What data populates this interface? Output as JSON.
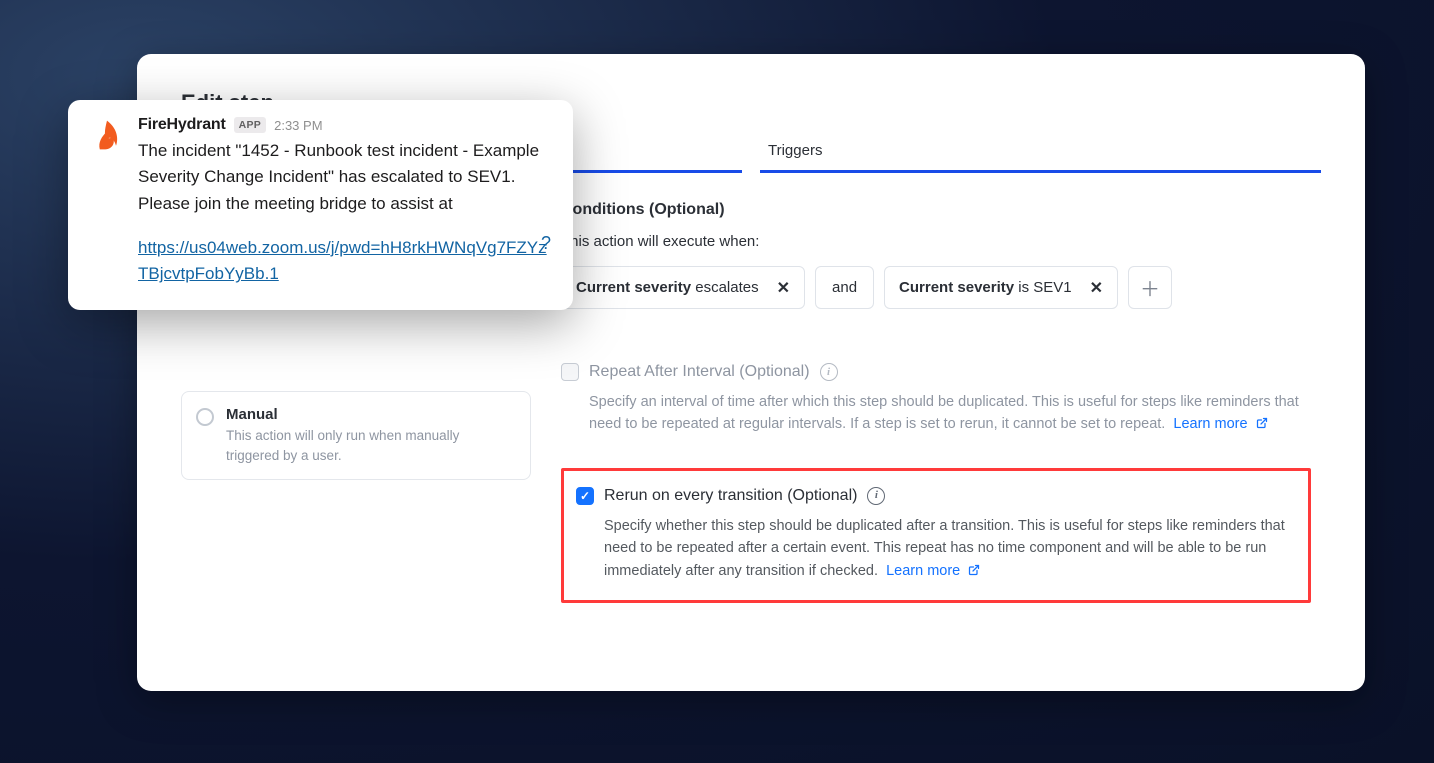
{
  "page": {
    "title": "Edit step"
  },
  "tabs": {
    "t1_label": "",
    "t2_label": "Triggers"
  },
  "radio_manual": {
    "title": "Manual",
    "desc": "This action will only run when manually triggered by a user."
  },
  "conditions": {
    "heading": "Conditions (Optional)",
    "intro": "This action will execute when:",
    "chip1_bold": "Current severity",
    "chip1_rest": "escalates",
    "logic": "and",
    "chip2_bold": "Current severity",
    "chip2_rest": "is SEV1"
  },
  "repeat": {
    "title": "Repeat After Interval (Optional)",
    "desc": "Specify an interval of time after which this step should be duplicated. This is useful for steps like reminders that need to be repeated at regular intervals. If a step is set to rerun, it cannot be set to repeat.",
    "learn": "Learn more"
  },
  "rerun": {
    "title": "Rerun on every transition (Optional)",
    "desc": "Specify whether this step should be duplicated after a transition. This is useful for steps like reminders that need to be repeated after a certain event. This repeat has no time component and will be able to be run immediately after any transition if checked.",
    "learn": "Learn more"
  },
  "slack": {
    "sender": "FireHydrant",
    "badge": "APP",
    "time": "2:33 PM",
    "message": "The incident \"1452 - Runbook test incident - Example Severity Change Incident\" has escalated to SEV1. Please join the meeting bridge to assist at",
    "link": "https://us04web.zoom.us/j/pwd=hH8rkHWNqVg7FZYzTBjcvtpFobYyBb.1",
    "help": "?"
  }
}
